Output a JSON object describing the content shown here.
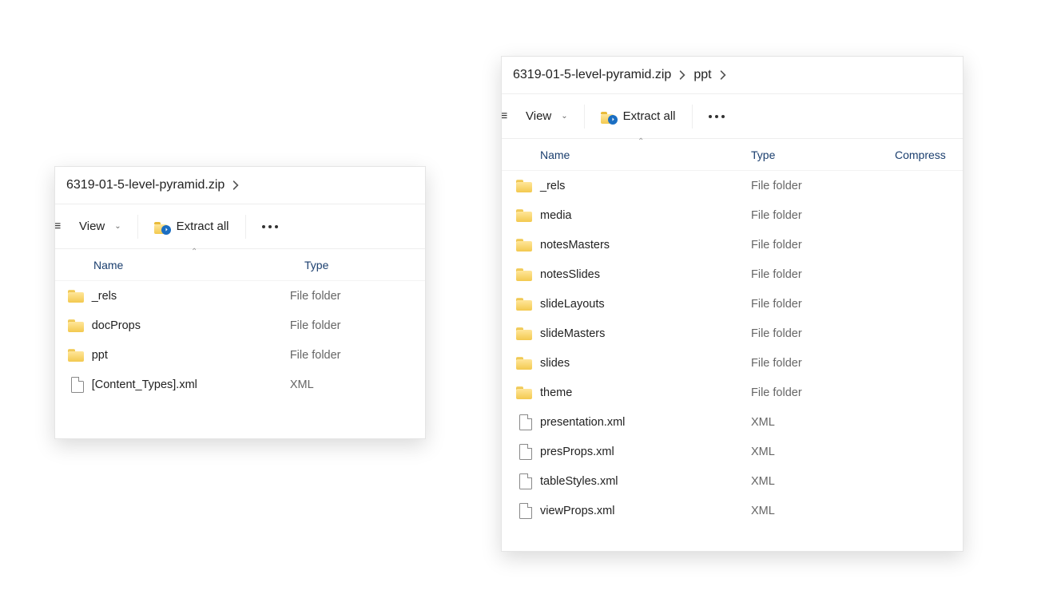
{
  "window1": {
    "breadcrumb": [
      "6319-01-5-level-pyramid.zip"
    ],
    "toolbar": {
      "view_label": "View",
      "extract_label": "Extract all"
    },
    "columns": {
      "name": "Name",
      "type": "Type"
    },
    "rows": [
      {
        "name": "_rels",
        "type": "File folder",
        "icon": "folder"
      },
      {
        "name": "docProps",
        "type": "File folder",
        "icon": "folder"
      },
      {
        "name": "ppt",
        "type": "File folder",
        "icon": "folder"
      },
      {
        "name": "[Content_Types].xml",
        "type": "XML",
        "icon": "file"
      }
    ]
  },
  "window2": {
    "breadcrumb": [
      "6319-01-5-level-pyramid.zip",
      "ppt"
    ],
    "toolbar": {
      "view_label": "View",
      "extract_label": "Extract all"
    },
    "columns": {
      "name": "Name",
      "type": "Type",
      "compress": "Compress"
    },
    "rows": [
      {
        "name": "_rels",
        "type": "File folder",
        "icon": "folder"
      },
      {
        "name": "media",
        "type": "File folder",
        "icon": "folder"
      },
      {
        "name": "notesMasters",
        "type": "File folder",
        "icon": "folder"
      },
      {
        "name": "notesSlides",
        "type": "File folder",
        "icon": "folder"
      },
      {
        "name": "slideLayouts",
        "type": "File folder",
        "icon": "folder"
      },
      {
        "name": "slideMasters",
        "type": "File folder",
        "icon": "folder"
      },
      {
        "name": "slides",
        "type": "File folder",
        "icon": "folder"
      },
      {
        "name": "theme",
        "type": "File folder",
        "icon": "folder"
      },
      {
        "name": "presentation.xml",
        "type": "XML",
        "icon": "file"
      },
      {
        "name": "presProps.xml",
        "type": "XML",
        "icon": "file"
      },
      {
        "name": "tableStyles.xml",
        "type": "XML",
        "icon": "file"
      },
      {
        "name": "viewProps.xml",
        "type": "XML",
        "icon": "file"
      }
    ]
  }
}
